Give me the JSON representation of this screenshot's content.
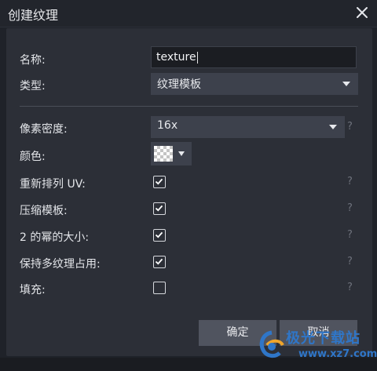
{
  "window": {
    "title": "创建纹理"
  },
  "form": {
    "name_label": "名称:",
    "name_value": "texture",
    "type_label": "类型:",
    "type_value": "纹理模板",
    "density_label": "像素密度:",
    "density_value": "16x",
    "color_label": "颜色:",
    "options": [
      {
        "label": "重新排列 UV:",
        "checked": true
      },
      {
        "label": "压缩模板:",
        "checked": true
      },
      {
        "label": "2 的幂的大小:",
        "checked": true
      },
      {
        "label": "保持多纹理占用:",
        "checked": true
      },
      {
        "label": "填充:",
        "checked": false
      }
    ],
    "help_symbol": "?"
  },
  "buttons": {
    "confirm": "确定",
    "cancel": "取消"
  },
  "watermark": {
    "text": "极光下载站",
    "url": "www.xz7.com"
  },
  "colors": {
    "accent": "#2f76c8",
    "background": "#2c2f37",
    "field": "#3d414c"
  }
}
